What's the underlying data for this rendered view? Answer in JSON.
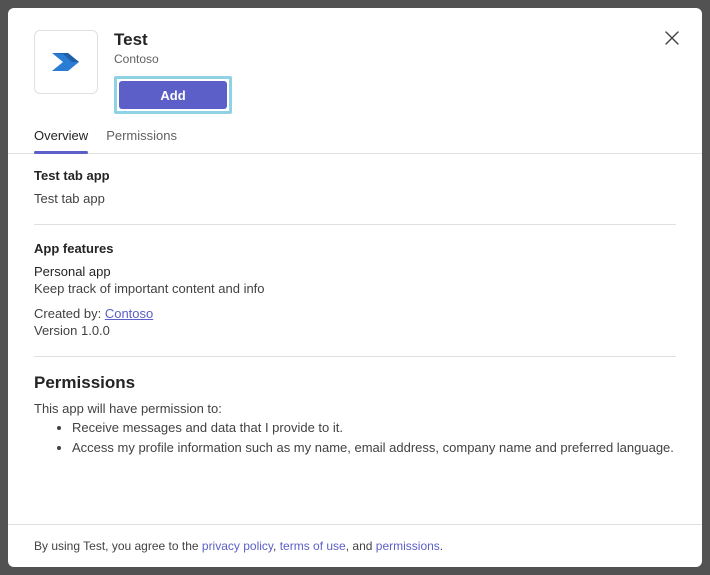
{
  "app": {
    "title": "Test",
    "publisher": "Contoso",
    "add_label": "Add"
  },
  "tabs": {
    "overview": "Overview",
    "permissions": "Permissions"
  },
  "test_tab": {
    "heading": "Test tab app",
    "desc": "Test tab app"
  },
  "features": {
    "heading": "App features",
    "subtype": "Personal app",
    "desc": "Keep track of important content and info",
    "created_by_label": "Created by: ",
    "created_by_link": "Contoso",
    "version": "Version 1.0.0"
  },
  "permissions": {
    "heading": "Permissions",
    "intro": "This app will have permission to:",
    "items": [
      "Receive messages and data that I provide to it.",
      "Access my profile information such as my name, email address, company name and preferred language."
    ]
  },
  "footer": {
    "prefix": "By using Test, you agree to the ",
    "privacy": "privacy policy",
    "sep1": ", ",
    "terms": "terms of use",
    "sep2": ", and ",
    "perms": "permissions",
    "suffix": "."
  }
}
